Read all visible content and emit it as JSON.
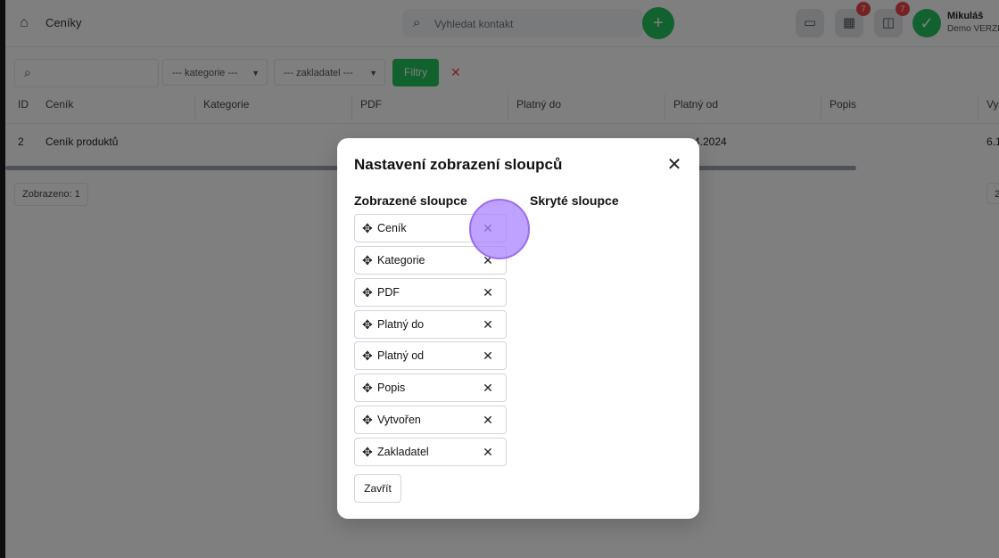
{
  "topbar": {
    "breadcrumb": "Ceníky",
    "search_placeholder": "Vyhledat kontakt",
    "add_label": "+",
    "badges": [
      "7",
      "7"
    ],
    "user_name": "Mikuláš",
    "user_role": "Demo VERZE"
  },
  "filterbar": {
    "category_select": "--- kategorie ---",
    "founder_select": "--- zakladatel ---",
    "filter_button": "Filtry",
    "clear_label": "✕"
  },
  "table": {
    "headers": [
      "ID",
      "Ceník",
      "Kategorie",
      "PDF",
      "Platný do",
      "Platný od",
      "Popis",
      "Vy"
    ],
    "row": {
      "id": "2",
      "cenik": "Ceník produktů",
      "platny_od": "4.2024",
      "vytvoren": "6.1"
    },
    "count_label": "Zobrazeno: 1",
    "page_label": "2"
  },
  "modal": {
    "title": "Nastavení zobrazení sloupců",
    "shown_title": "Zobrazené sloupce",
    "hidden_title": "Skryté sloupce",
    "shown_columns": [
      "Ceník",
      "Kategorie",
      "PDF",
      "Platný do",
      "Platný od",
      "Popis",
      "Vytvořen",
      "Zakladatel"
    ],
    "close_button": "Zavřít"
  },
  "icons": {
    "close": "close-icon",
    "move": "move-icon",
    "remove": "remove-icon"
  },
  "colors": {
    "accent": "#22c55e",
    "badge": "#ef4444",
    "click_highlight": "#a982ff"
  }
}
